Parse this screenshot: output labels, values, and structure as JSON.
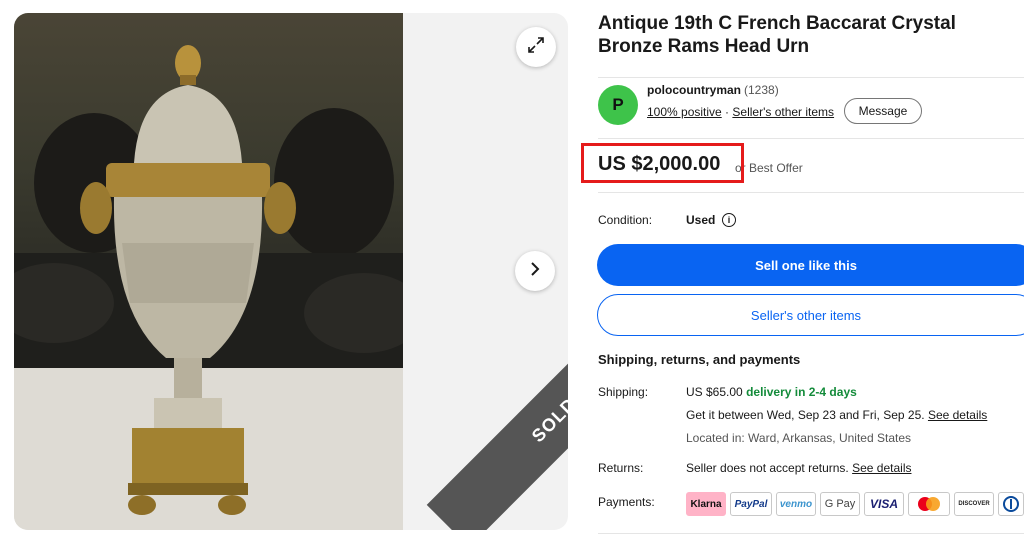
{
  "listing": {
    "title": "Antique 19th C French Baccarat Crystal Bronze Rams Head Urn",
    "sold_label": "SOLD"
  },
  "seller": {
    "avatar_letter": "P",
    "name": "polocountryman",
    "feedback_count": "(1238)",
    "positive": "100% positive",
    "separator": " · ",
    "other_items": "Seller's other items",
    "message_label": "Message"
  },
  "price": {
    "amount": "US $2,000.00",
    "offer": "or Best Offer"
  },
  "condition": {
    "label": "Condition:",
    "value": "Used",
    "info_icon": "i"
  },
  "actions": {
    "primary": "Sell one like this",
    "secondary": "Seller's other items"
  },
  "shipping": {
    "heading": "Shipping, returns, and payments",
    "shipping_label": "Shipping:",
    "shipping_cost": "US $65.00",
    "delivery": "delivery in 2-4 days",
    "delivery_window": "Get it between Wed, Sep 23 and Fri, Sep 25.",
    "see_details": "See details",
    "location": "Located in: Ward, Arkansas, United States",
    "returns_label": "Returns:",
    "returns_text": "Seller does not accept returns.",
    "payments_label": "Payments:"
  },
  "payments": [
    "Klarna",
    "PayPal",
    "venmo",
    "G Pay",
    "VISA",
    "",
    "DISCOVER",
    ""
  ],
  "colors": {
    "accent_blue": "#0964f2",
    "green": "#138b3a",
    "highlight_red": "#e51b1b",
    "avatar_green": "#3ec34a"
  },
  "icons": [
    "expand-icon",
    "chevron-right-icon",
    "info-icon"
  ]
}
